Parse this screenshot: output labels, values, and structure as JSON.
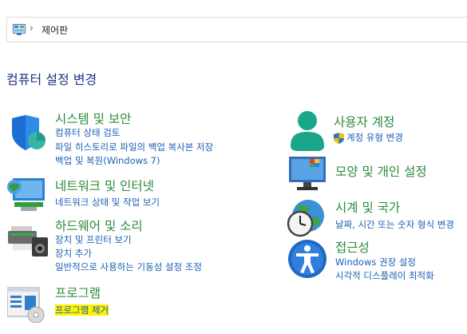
{
  "address_bar": {
    "icon": "control-panel-icon",
    "location": "제어판"
  },
  "page_title": "컴퓨터 설정 변경",
  "categories": {
    "system_security": {
      "title": "시스템 및 보안",
      "icon": "shield-icon",
      "links": [
        "컴퓨터 상태 검토",
        "파일 히스토리로 파일의 백업 복사본 저장",
        "백업 및 복원(Windows 7)"
      ]
    },
    "network": {
      "title": "네트워크 및 인터넷",
      "icon": "network-monitor-icon",
      "links": [
        "네트워크 상태 및 작업 보기"
      ]
    },
    "hardware": {
      "title": "하드웨어 및 소리",
      "icon": "printer-speaker-icon",
      "links": [
        "장치 및 프린터 보기",
        "장치 추가",
        "일반적으로 사용하는 기동성 설정 조정"
      ]
    },
    "programs": {
      "title": "프로그램",
      "icon": "programs-icon",
      "links": [
        "프로그램 제거"
      ]
    },
    "user_accounts": {
      "title": "사용자 계정",
      "icon": "user-icon",
      "links": [
        "계정 유형 변경"
      ]
    },
    "appearance": {
      "title": "모양 및 개인 설정",
      "icon": "display-icon",
      "links": []
    },
    "clock_region": {
      "title": "시계 및 국가",
      "icon": "clock-globe-icon",
      "links": [
        "날짜, 시간 또는 숫자 형식 변경"
      ]
    },
    "ease_of_access": {
      "title": "접근성",
      "icon": "accessibility-icon",
      "links": [
        "Windows 권장 설정",
        "시각적 디스플레이 최적화"
      ]
    }
  },
  "colors": {
    "title": "#1e3287",
    "category": "#2a8a3a",
    "link": "#1a5fb4",
    "highlight": "#fff200"
  }
}
